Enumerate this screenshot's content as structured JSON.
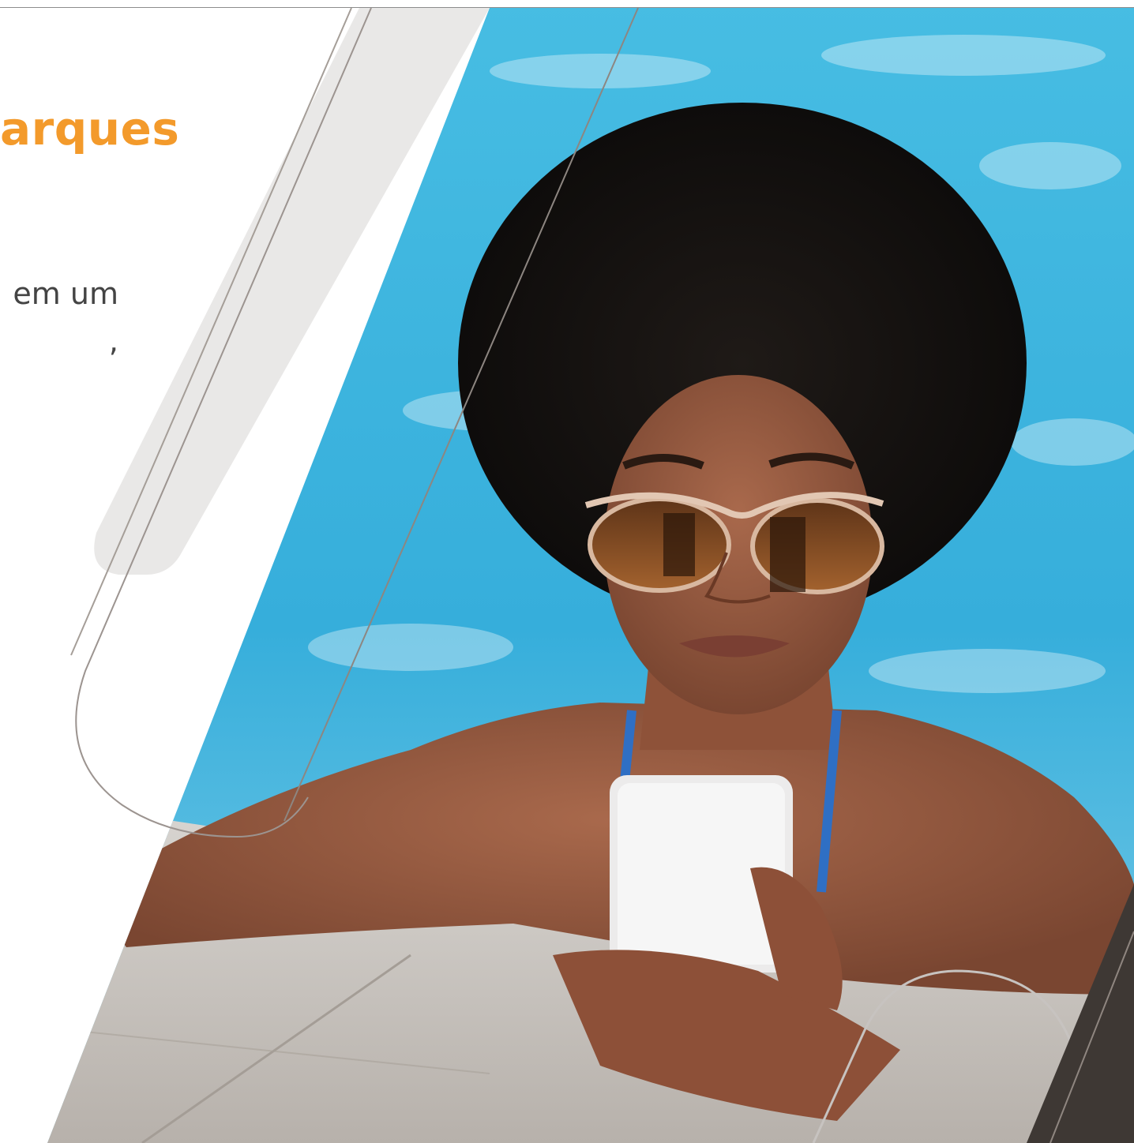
{
  "content": {
    "headline": "arques",
    "body_lines": [
      "em um",
      ","
    ]
  },
  "colors": {
    "headline": "#f39a2b",
    "body_text": "#444444",
    "pale_stripe": "#e9e8e7",
    "outline_line": "#9c9490",
    "dark_corner": "#3e3834",
    "pool_water": "#3fb4dc"
  },
  "photo": {
    "icon": "photo-woman-with-phone-in-pool"
  }
}
